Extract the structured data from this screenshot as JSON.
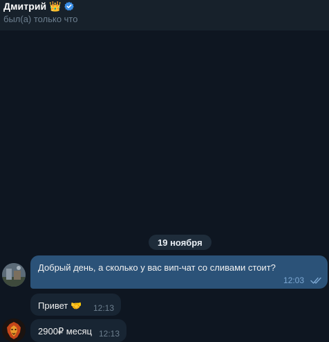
{
  "header": {
    "contact_name": "Дмитрий",
    "crown_emoji": "👑",
    "verified_icon": "verified-badge-icon",
    "status": "был(а) только что"
  },
  "chat": {
    "date_separator": "19 ноября",
    "messages": [
      {
        "direction": "outgoing",
        "text": "Добрый день, а сколько у вас вип-чат со сливами стоит?",
        "time": "12:03",
        "read_status": "read-double-check-icon"
      },
      {
        "direction": "incoming",
        "text": "Привет 🤝",
        "time": "12:13"
      },
      {
        "direction": "incoming",
        "text": "2900₽ месяц",
        "time": "12:13"
      }
    ]
  },
  "colors": {
    "background": "#0e1621",
    "header": "#17212b",
    "outgoing_bubble": "#2b5278",
    "incoming_bubble": "#182533",
    "verified": "#3a8ee6"
  }
}
